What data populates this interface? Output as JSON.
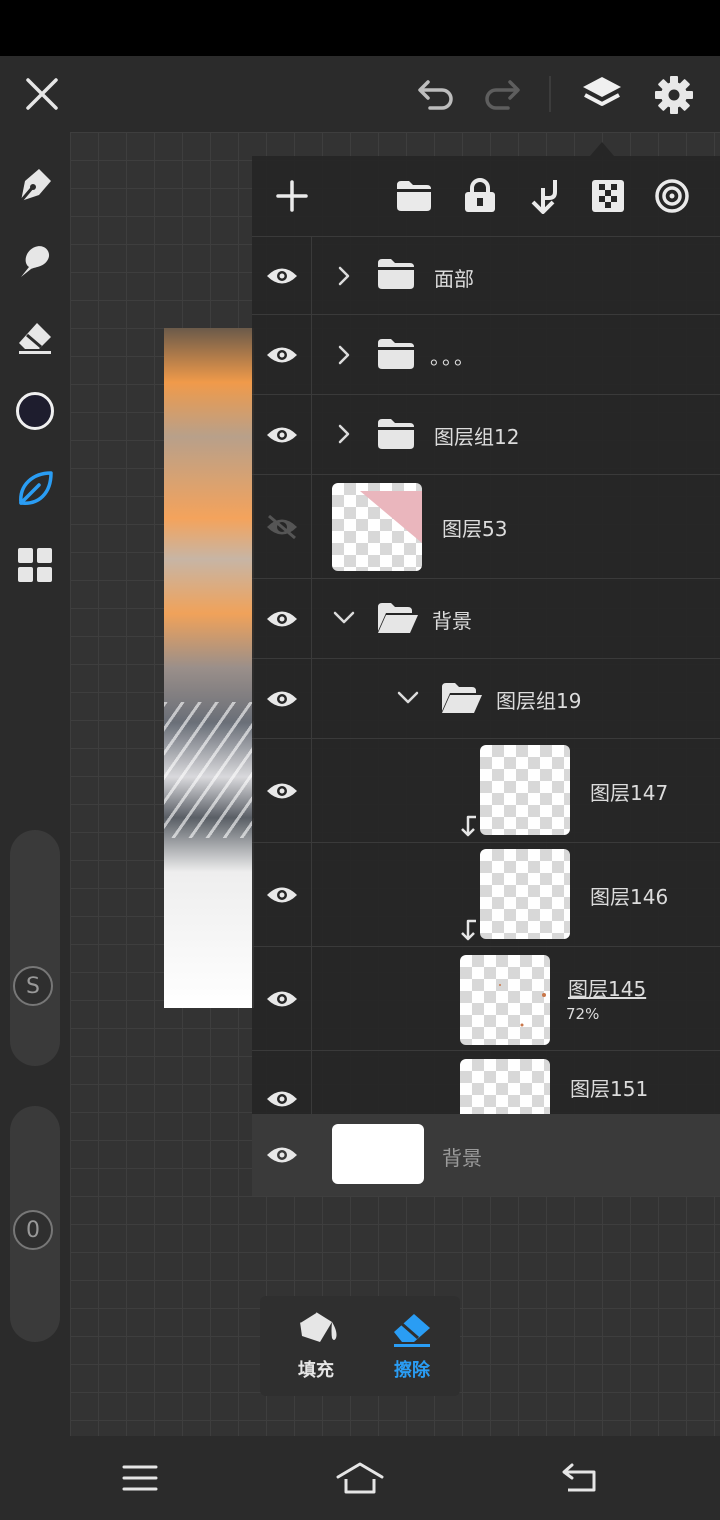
{
  "app": {
    "top_toolbar": {
      "close": "close-icon",
      "undo": "undo-icon",
      "redo": "redo-icon",
      "layers": "layers-icon",
      "settings": "gear-icon"
    },
    "left_toolbar": {
      "tools": [
        "pen-icon",
        "smudge-icon",
        "eraser-icon",
        "color-swatch",
        "leaf-icon",
        "grid-icon"
      ],
      "active_color": "#1e1d2e",
      "size_knob": "S",
      "opacity_knob": "0"
    },
    "layers_panel": {
      "toolbar": [
        "add-icon",
        "folder-icon",
        "lock-icon",
        "merge-down-icon",
        "transparency-icon",
        "target-icon"
      ],
      "rows": [
        {
          "label": "面部",
          "type": "folder",
          "expanded": false
        },
        {
          "label": "。。。",
          "type": "folder",
          "expanded": false
        },
        {
          "label": "图层组12",
          "type": "folder",
          "expanded": false
        },
        {
          "label": "图层53",
          "type": "layer",
          "hidden": true
        },
        {
          "label": "背景",
          "type": "folder",
          "expanded": true
        },
        {
          "label": "图层组19",
          "type": "folder",
          "expanded": true
        },
        {
          "label": "图层147",
          "type": "layer",
          "clipped": true
        },
        {
          "label": "图层146",
          "type": "layer",
          "clipped": true
        },
        {
          "label": "图层145",
          "type": "layer",
          "opacity": "72%"
        },
        {
          "label": "图层151",
          "type": "layer"
        }
      ],
      "background_row": {
        "label": "背景"
      }
    },
    "fill_popup": {
      "fill_label": "填充",
      "erase_label": "擦除",
      "accent": "#2a9df4"
    }
  }
}
